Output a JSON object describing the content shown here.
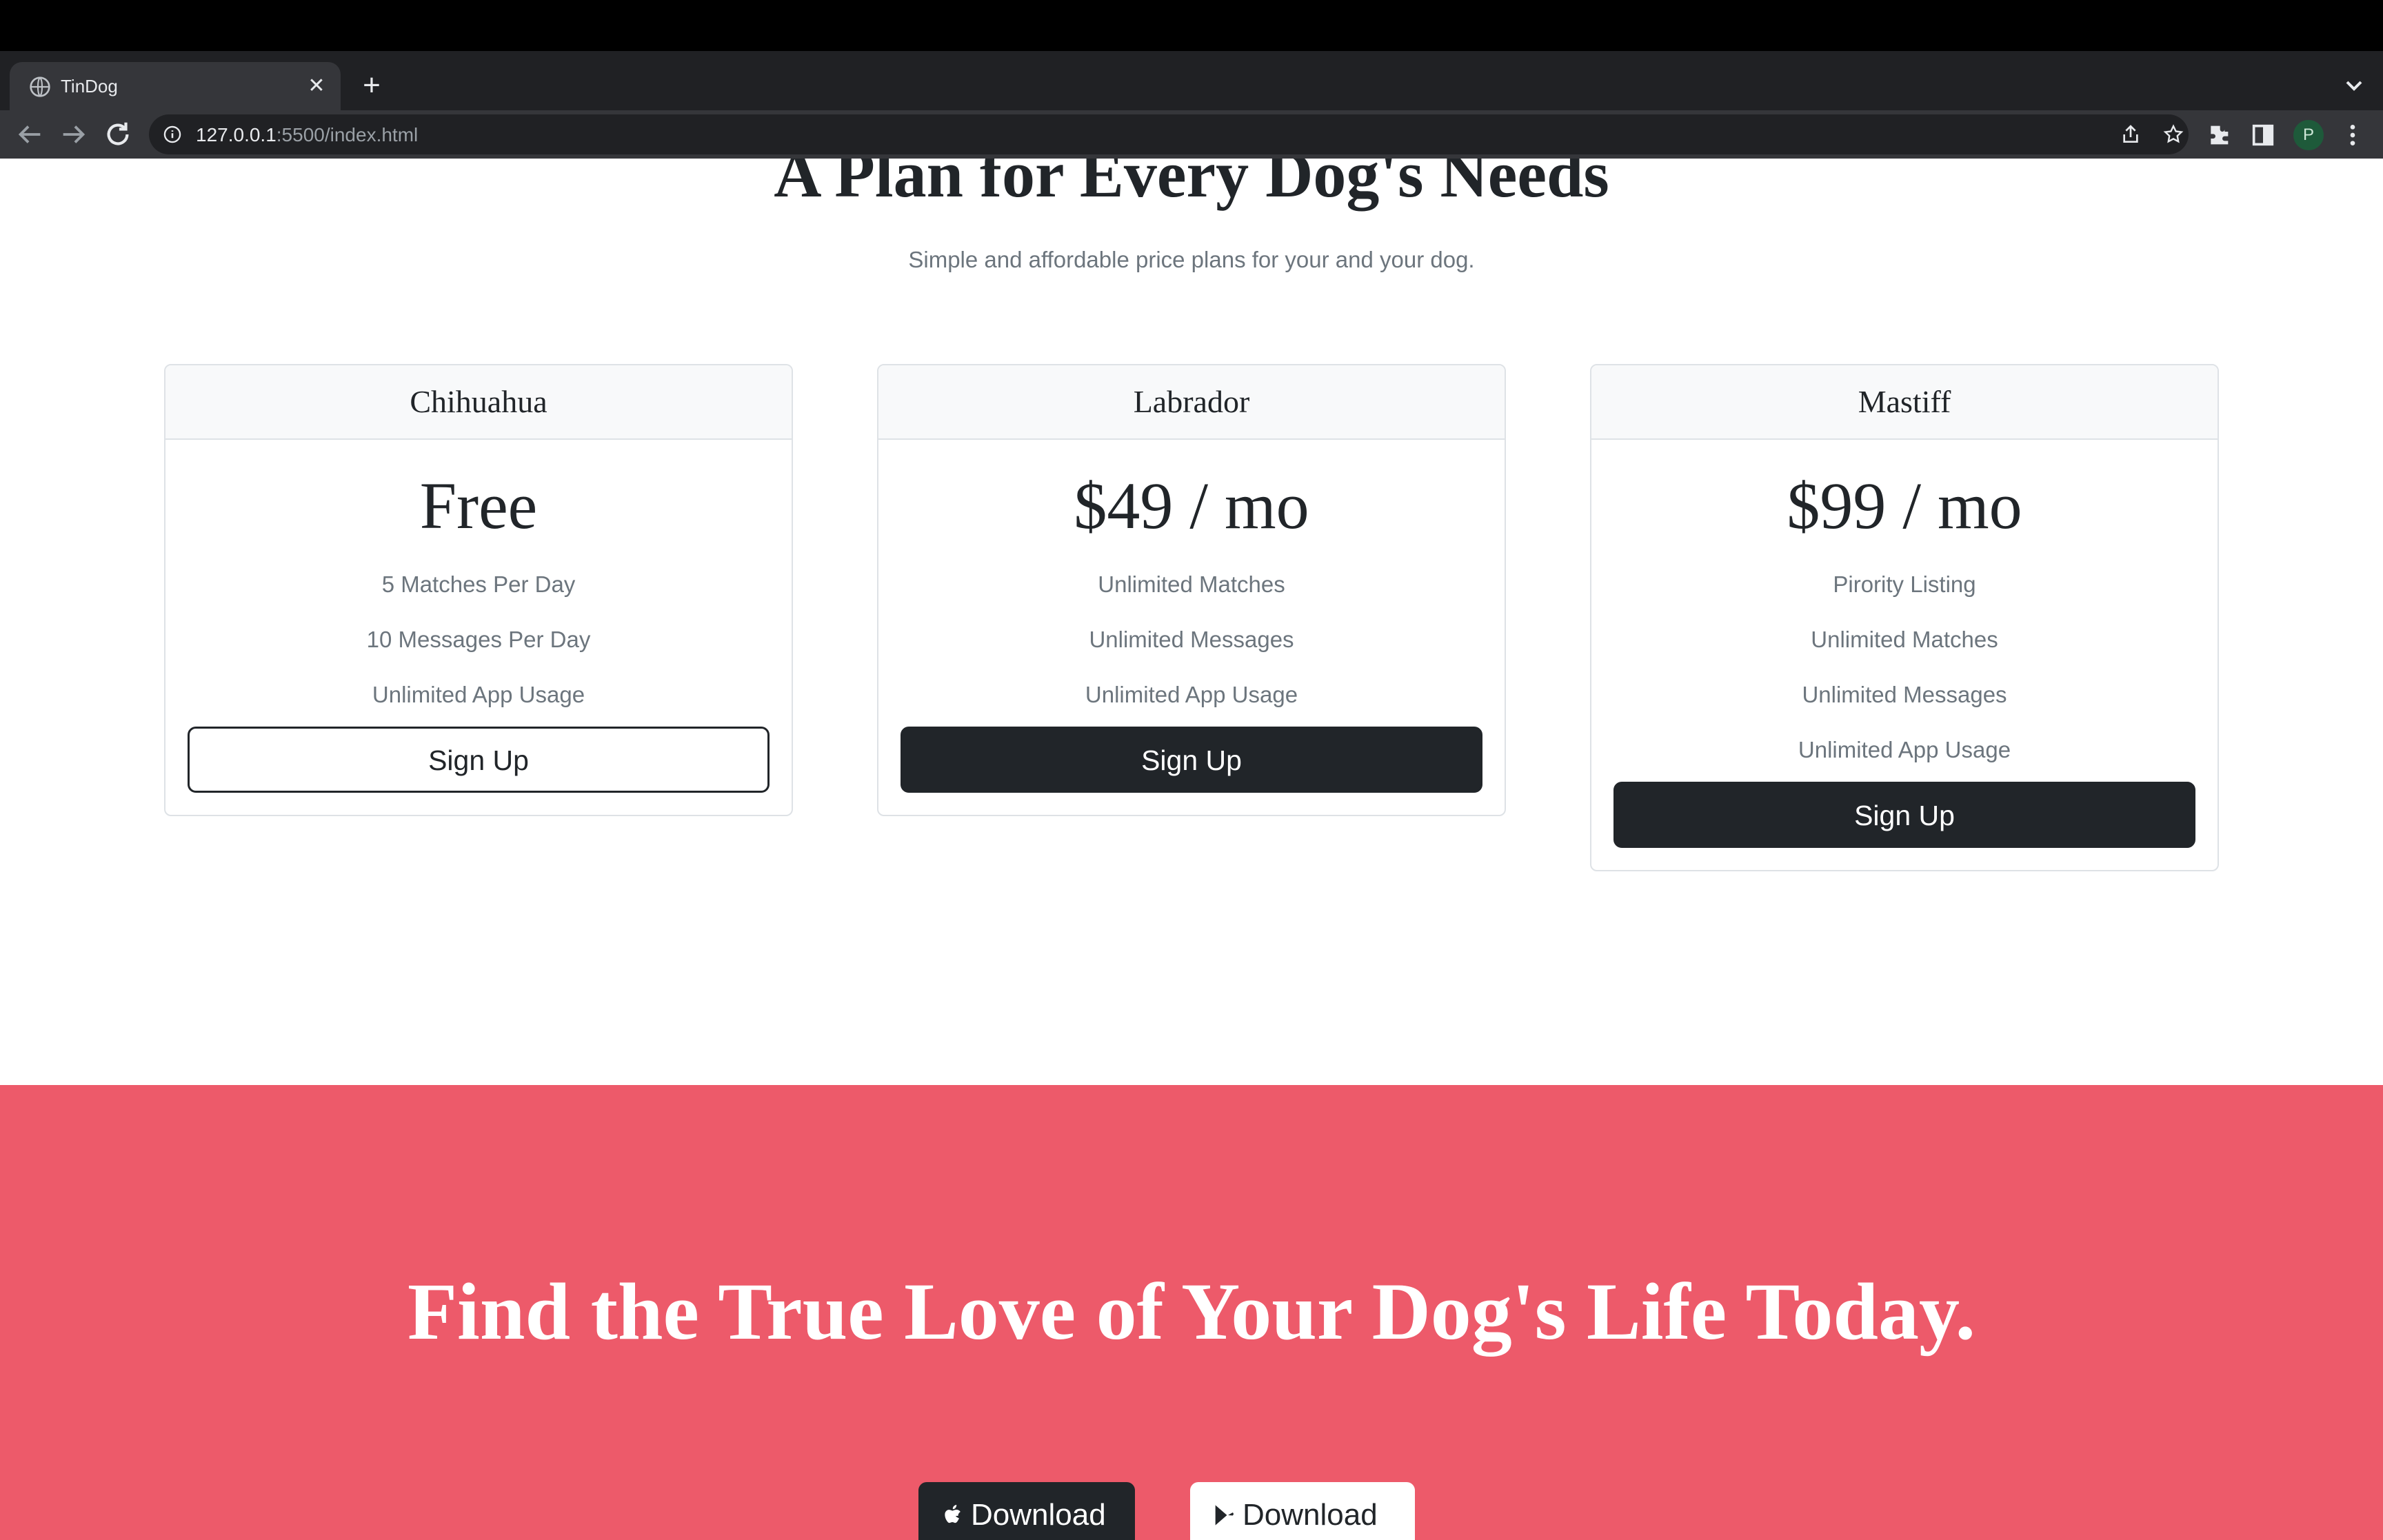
{
  "browser": {
    "tab_title": "TinDog",
    "tab_close": "✕",
    "new_tab": "+",
    "url_host": "127.0.0.1",
    "url_rest": ":5500/index.html",
    "profile_initial": "P"
  },
  "pricing": {
    "title": "A Plan for Every Dog's Needs",
    "subtitle": "Simple and affordable price plans for your and your dog.",
    "plans": [
      {
        "name": "Chihuahua",
        "price": "Free",
        "features": [
          "5 Matches Per Day",
          "10 Messages Per Day",
          "Unlimited App Usage"
        ],
        "button": "Sign Up"
      },
      {
        "name": "Labrador",
        "price": "$49 / mo",
        "features": [
          "Unlimited Matches",
          "Unlimited Messages",
          "Unlimited App Usage"
        ],
        "button": "Sign Up"
      },
      {
        "name": "Mastiff",
        "price": "$99 / mo",
        "features": [
          "Pirority Listing",
          "Unlimited Matches",
          "Unlimited Messages",
          "Unlimited App Usage"
        ],
        "button": "Sign Up"
      }
    ]
  },
  "cta": {
    "title": "Find the True Love of Your Dog's Life Today.",
    "apple_download": "Download",
    "google_download": "Download"
  },
  "colors": {
    "cta_background": "#ed5a6a",
    "dark_button": "#212529"
  }
}
